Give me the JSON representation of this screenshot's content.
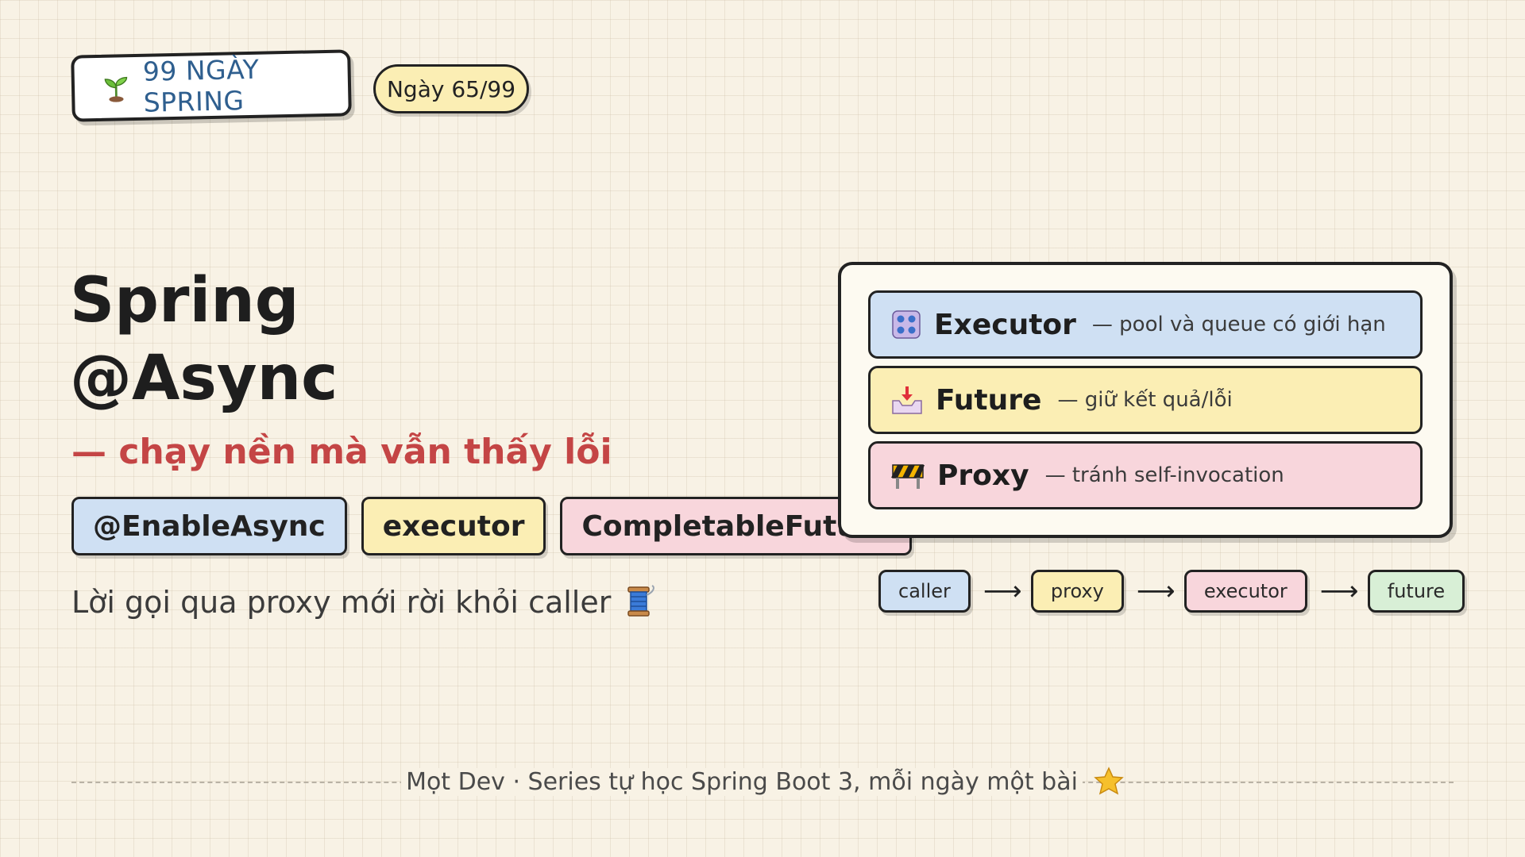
{
  "header": {
    "brand_label": "99 NGÀY SPRING",
    "brand_icon": "seedling-icon",
    "day_label": "Ngày 65/99"
  },
  "title": {
    "line1": "Spring",
    "line2": "@Async",
    "subtitle": "— chạy nền mà vẫn thấy lỗi"
  },
  "tags": [
    {
      "label": "@EnableAsync",
      "color": "#cfe0f3"
    },
    {
      "label": "executor",
      "color": "#fbeeb4"
    },
    {
      "label": "CompletableFuture",
      "color": "#f8d6dc"
    }
  ],
  "note": {
    "text": "Lời gọi qua proxy mới rời khỏi caller",
    "icon": "thread-spool-icon"
  },
  "panel": {
    "rows": [
      {
        "title": "Executor",
        "desc": "— pool và queue có giới hạn",
        "icon": "control-knobs-icon",
        "color": "#cfe0f3"
      },
      {
        "title": "Future",
        "desc": "— giữ kết quả/lỗi",
        "icon": "inbox-tray-icon",
        "color": "#fbeeb4"
      },
      {
        "title": "Proxy",
        "desc": "— tránh self-invocation",
        "icon": "construction-barrier-icon",
        "color": "#f8d6dc"
      }
    ]
  },
  "flow": {
    "nodes": [
      {
        "label": "caller",
        "color": "#cfe0f3"
      },
      {
        "label": "proxy",
        "color": "#fbeeb4"
      },
      {
        "label": "executor",
        "color": "#f8d6dc"
      },
      {
        "label": "future",
        "color": "#d8efd6"
      }
    ],
    "arrow": "⟶"
  },
  "footer": {
    "text": "Mọt Dev · Series tự học Spring Boot 3, mỗi ngày một bài",
    "icon": "star-icon"
  }
}
